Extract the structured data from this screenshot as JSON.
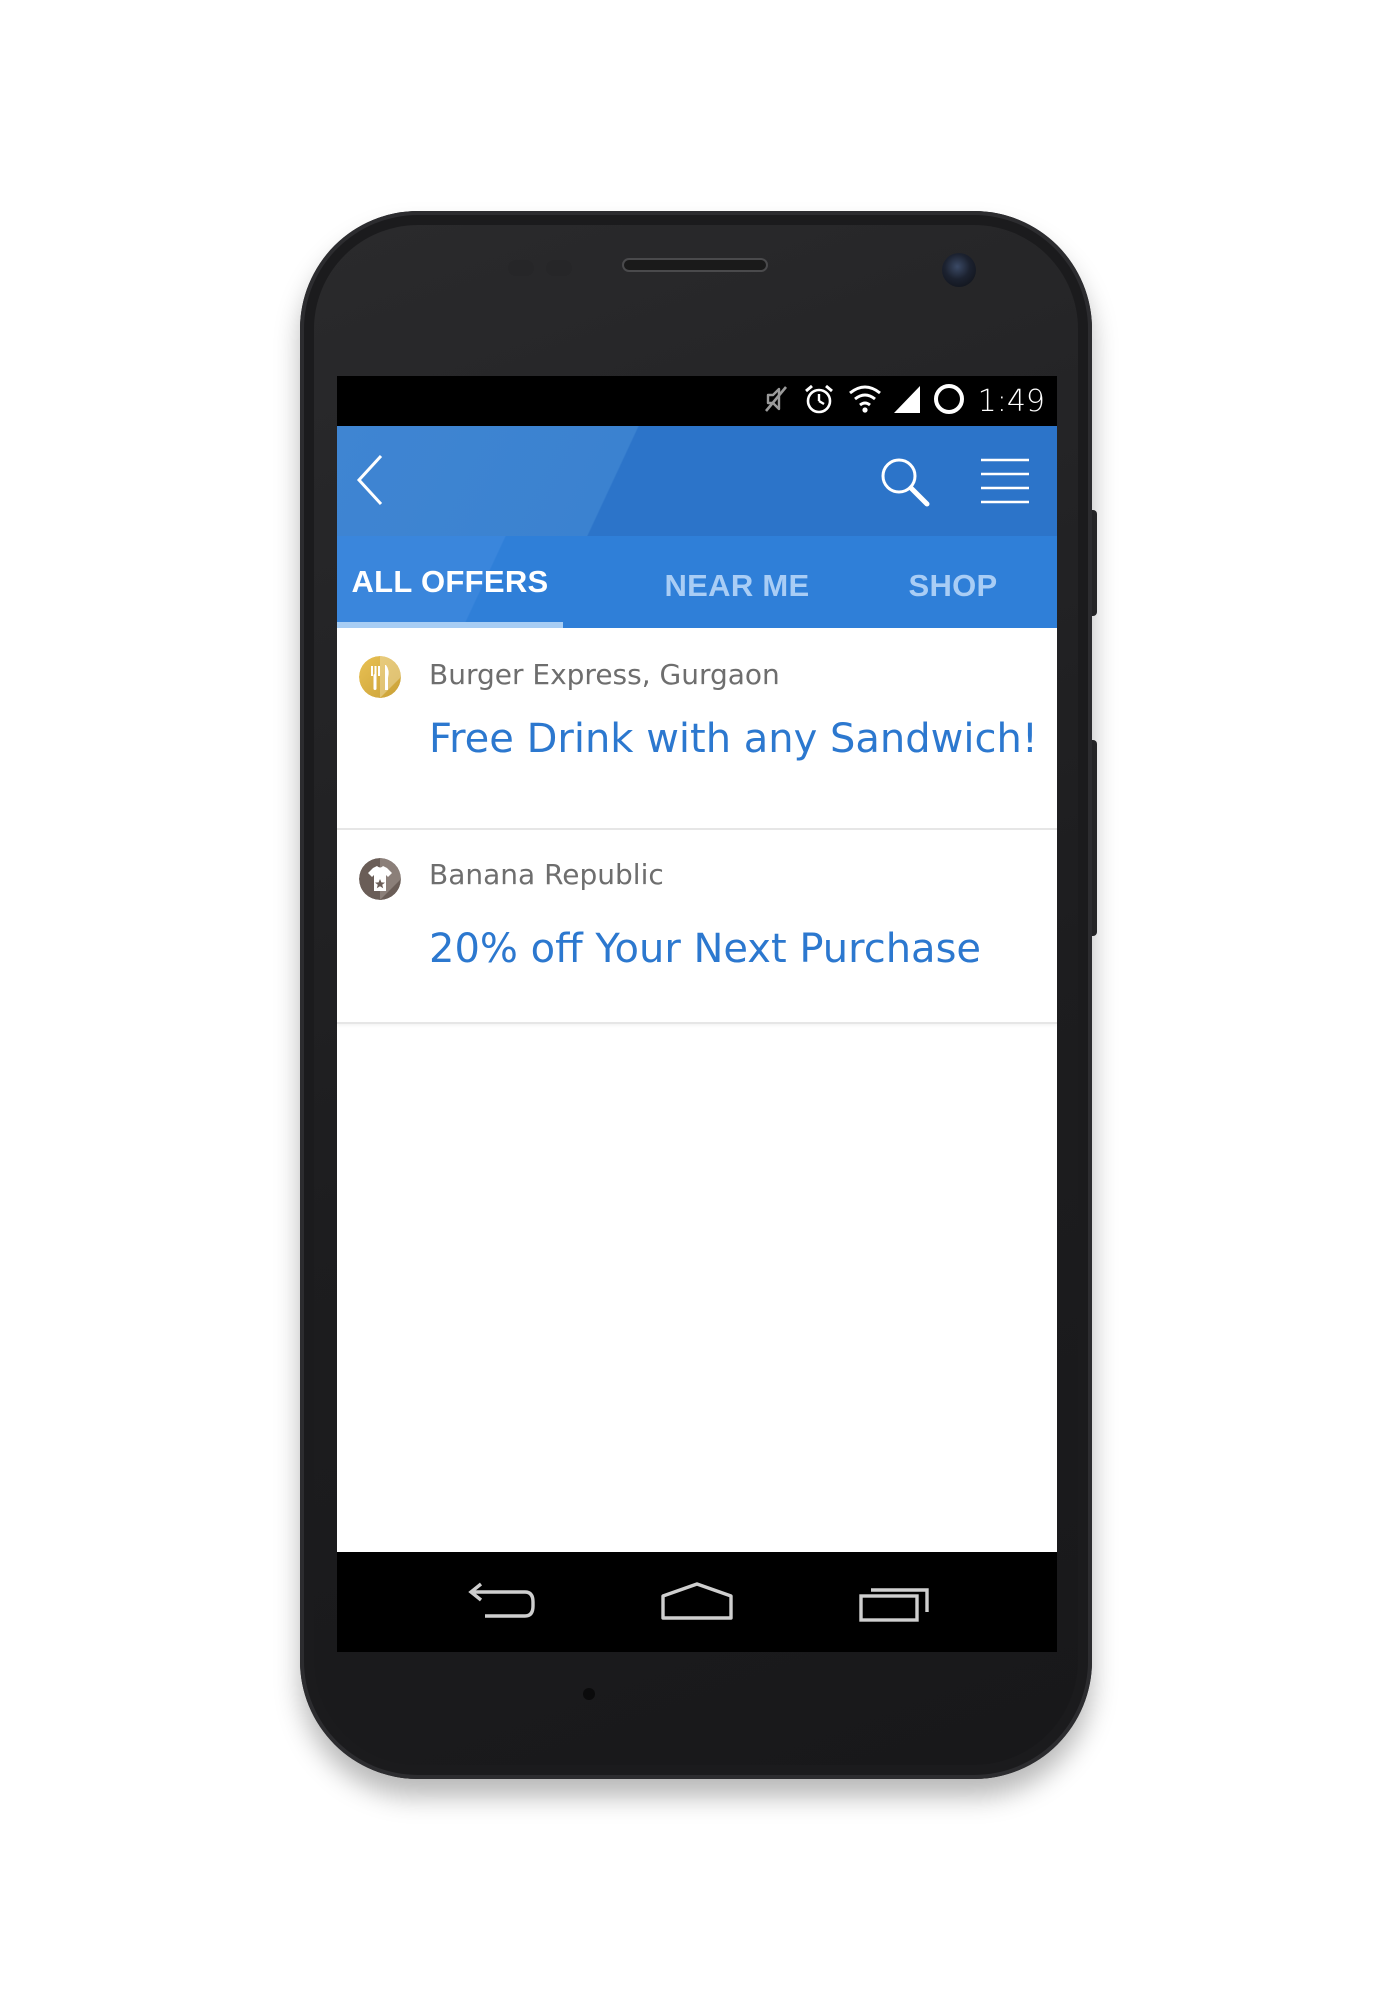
{
  "status_bar": {
    "time": "1:49",
    "icons": [
      "mute-icon",
      "alarm-icon",
      "wifi-icon",
      "signal-icon",
      "battery-icon"
    ]
  },
  "app_bar": {
    "background_color": "#2c74c9",
    "icons": [
      "back-arrow-icon",
      "search-icon",
      "hamburger-menu-icon"
    ]
  },
  "tabs": [
    {
      "label": "ALL OFFERS",
      "active": true
    },
    {
      "label": "NEAR ME",
      "active": false
    },
    {
      "label": "SHOP",
      "active": false
    }
  ],
  "offers": [
    {
      "merchant": "Burger Express, Gurgaon",
      "title": "Free Drink with any Sandwich!",
      "icon": "food-utensils-icon",
      "icon_color": "#e0b848"
    },
    {
      "merchant": "Banana Republic",
      "title": "20% off Your Next Purchase",
      "icon": "shirt-icon",
      "icon_color": "#6a5d57"
    }
  ],
  "nav_bar": {
    "icons": [
      "back-nav-icon",
      "home-nav-icon",
      "recent-apps-icon"
    ]
  },
  "colors": {
    "accent": "#2c78cf",
    "tab_inactive": "#a9cdf5",
    "merchant_text": "#6e6e6e"
  }
}
